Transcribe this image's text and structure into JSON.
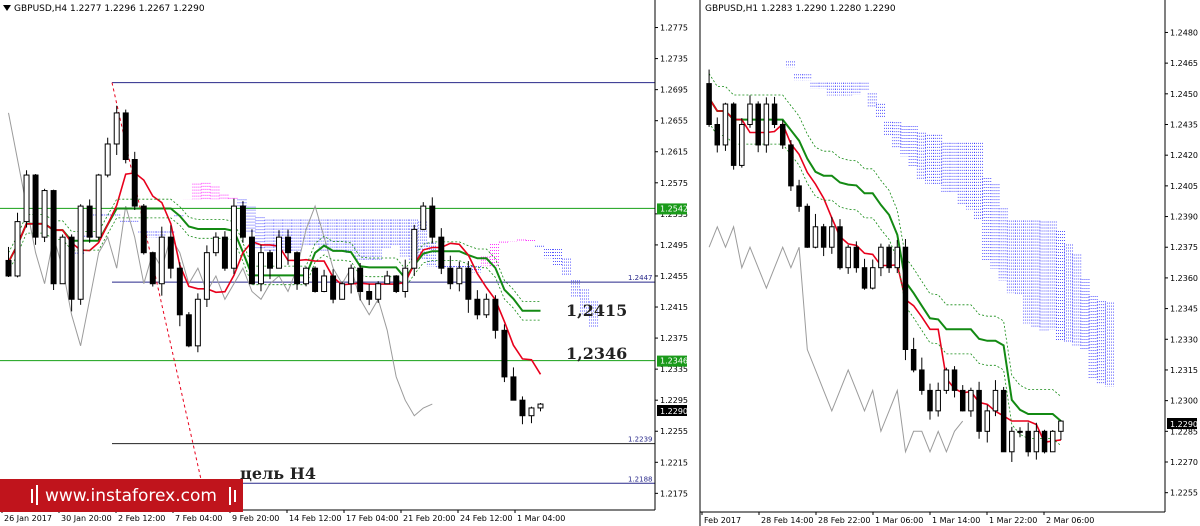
{
  "colors": {
    "background": "#ffffff",
    "frame": "#000000",
    "candle": "#000000",
    "tenkan": "#e8001c",
    "kijun": "#138a13",
    "chikou": "#9b9b9b",
    "cloud_bull": "#ff00ff",
    "cloud_bear": "#2d2dff",
    "level_green": "#16a016",
    "level_blue": "#28288a",
    "level_dark": "#222222",
    "price_badge_bg": "#000000",
    "price_badge_fg": "#ffffff",
    "green_badge_bg": "#1a9a1a",
    "brand_bg": "#c0141c",
    "brand_fg": "#ffffff"
  },
  "panel_left": {
    "header": "GBPUSD,H4  1.2277 1.2296 1.2267 1.2290",
    "price_tag": "1.2290",
    "annotations": [
      "1,2415",
      "1,2346",
      "цель H4"
    ],
    "level_tags": [
      {
        "text": "1.2542",
        "style": "green"
      },
      {
        "text": "1.2346",
        "style": "green"
      },
      {
        "text": "1.2447",
        "style": "plain"
      },
      {
        "text": "1.2239",
        "style": "plain"
      },
      {
        "text": "1.2188",
        "style": "plain"
      }
    ]
  },
  "panel_right": {
    "header": "GBPUSD,H1  1.2283 1.2290 1.2280 1.2290",
    "price_tag": "1.2290"
  },
  "brand": {
    "text": "www.instaforex.com",
    "icon": "candlestick-bars-icon"
  },
  "chart_data": [
    {
      "type": "candlestick",
      "symbol": "GBPUSD",
      "timeframe": "H4",
      "ohlc_last": {
        "open": 1.2277,
        "high": 1.2296,
        "low": 1.2267,
        "close": 1.229
      },
      "y_axis_ticks": [
        1.2775,
        1.2735,
        1.2695,
        1.2655,
        1.2615,
        1.2575,
        1.2535,
        1.2495,
        1.2455,
        1.2415,
        1.2375,
        1.2335,
        1.2295,
        1.2255,
        1.2215,
        1.2175
      ],
      "ylim": [
        1.216,
        1.2795
      ],
      "x_axis_ticks": [
        "26 Jan 2017",
        "30 Jan 20:00",
        "2 Feb 12:00",
        "7 Feb 04:00",
        "9 Feb 20:00",
        "14 Feb 12:00",
        "17 Feb 04:00",
        "21 Feb 20:00",
        "24 Feb 12:00",
        "1 Mar 04:00"
      ],
      "current_price": 1.229,
      "horizontal_levels": [
        {
          "value": 1.2704,
          "color": "blue"
        },
        {
          "value": 1.2542,
          "color": "green"
        },
        {
          "value": 1.2447,
          "color": "blue"
        },
        {
          "value": 1.2346,
          "color": "green"
        },
        {
          "value": 1.2239,
          "color": "dark"
        },
        {
          "value": 1.2188,
          "color": "blue"
        }
      ],
      "closes": [
        1.2455,
        1.2525,
        1.2585,
        1.2505,
        1.2565,
        1.2445,
        1.2505,
        1.2425,
        1.2545,
        1.2505,
        1.2585,
        1.2625,
        1.2665,
        1.2605,
        1.2545,
        1.2485,
        1.2445,
        1.2505,
        1.2465,
        1.2405,
        1.2365,
        1.2425,
        1.2485,
        1.2505,
        1.2465,
        1.2545,
        1.2505,
        1.2445,
        1.2485,
        1.2465,
        1.2505,
        1.2485,
        1.2445,
        1.2465,
        1.2435,
        1.2455,
        1.2425,
        1.2445,
        1.2465,
        1.2435,
        1.2425,
        1.2445,
        1.2455,
        1.2435,
        1.2465,
        1.2515,
        1.2545,
        1.2505,
        1.2465,
        1.2445,
        1.2465,
        1.2425,
        1.2405,
        1.2425,
        1.2385,
        1.2325,
        1.2295,
        1.2275,
        1.2285,
        1.229
      ]
    },
    {
      "type": "candlestick",
      "symbol": "GBPUSD",
      "timeframe": "H1",
      "ohlc_last": {
        "open": 1.2283,
        "high": 1.229,
        "low": 1.228,
        "close": 1.229
      },
      "y_axis_ticks": [
        1.248,
        1.2465,
        1.245,
        1.2435,
        1.242,
        1.2405,
        1.239,
        1.2375,
        1.236,
        1.2345,
        1.233,
        1.2315,
        1.23,
        1.2285,
        1.227,
        1.2255
      ],
      "ylim": [
        1.2248,
        1.249
      ],
      "x_axis_ticks": [
        "Feb 2017",
        "28 Feb 14:00",
        "28 Feb 22:00",
        "1 Mar 06:00",
        "1 Mar 14:00",
        "1 Mar 22:00",
        "2 Mar 06:00"
      ],
      "current_price": 1.229,
      "closes": [
        1.2435,
        1.2425,
        1.2445,
        1.2415,
        1.2435,
        1.2445,
        1.2425,
        1.2445,
        1.2435,
        1.2425,
        1.2405,
        1.2395,
        1.2375,
        1.2385,
        1.2375,
        1.2385,
        1.2365,
        1.2375,
        1.2365,
        1.2355,
        1.2365,
        1.2375,
        1.2365,
        1.2375,
        1.2325,
        1.2315,
        1.2305,
        1.2295,
        1.2305,
        1.2315,
        1.2305,
        1.2295,
        1.2305,
        1.2285,
        1.2295,
        1.2305,
        1.2275,
        1.2285,
        1.2285,
        1.2275,
        1.2285,
        1.2275,
        1.2285,
        1.229
      ]
    }
  ]
}
